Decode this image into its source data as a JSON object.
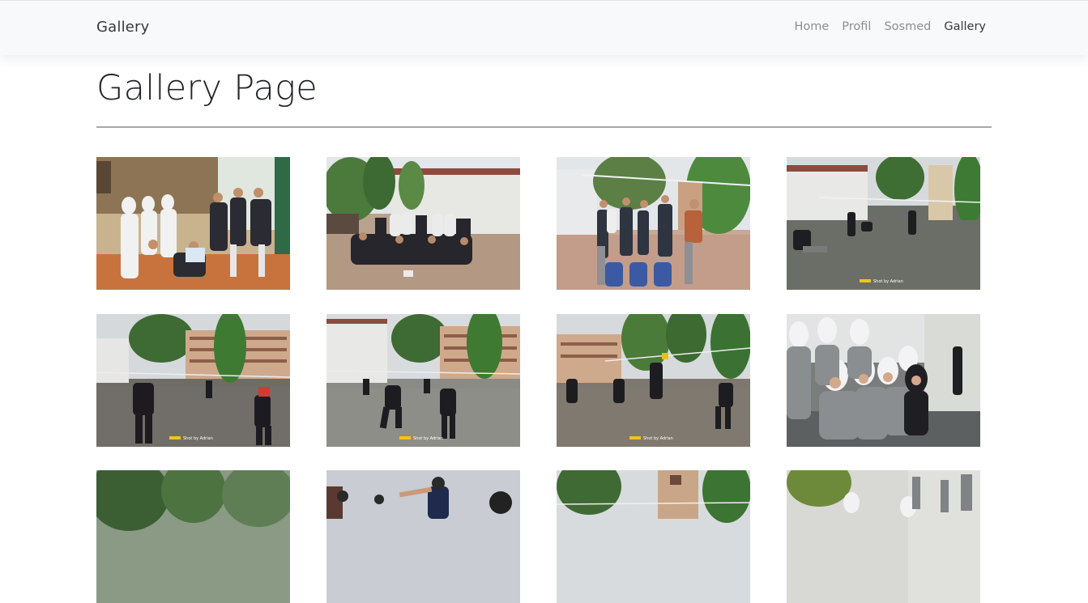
{
  "navbar": {
    "brand": "Gallery",
    "items": [
      {
        "label": "Home",
        "active": false
      },
      {
        "label": "Profil",
        "active": false
      },
      {
        "label": "Sosmed",
        "active": false
      },
      {
        "label": "Gallery",
        "active": true
      }
    ]
  },
  "page": {
    "title": "Gallery Page"
  },
  "gallery": {
    "photos": [
      {
        "watermark": ""
      },
      {
        "watermark": ""
      },
      {
        "watermark": ""
      },
      {
        "watermark": "Shot by Adrian"
      },
      {
        "watermark": "Shot by Adrian"
      },
      {
        "watermark": "Shot by Adrian"
      },
      {
        "watermark": "Shot by Adrian"
      },
      {
        "watermark": ""
      },
      {
        "watermark": ""
      },
      {
        "watermark": ""
      },
      {
        "watermark": ""
      },
      {
        "watermark": ""
      }
    ]
  }
}
